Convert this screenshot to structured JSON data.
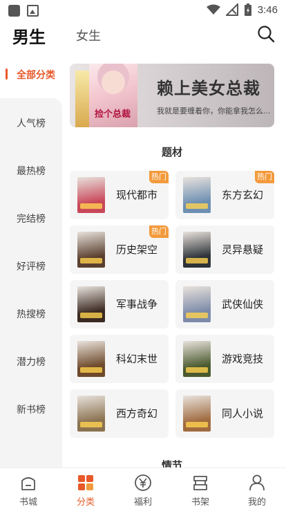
{
  "status_bar": {
    "time": "3:46"
  },
  "header": {
    "tabs": [
      {
        "label": "男生"
      },
      {
        "label": "女生"
      }
    ]
  },
  "sidebar": {
    "items": [
      {
        "label": "全部分类",
        "active": true
      },
      {
        "label": "人气榜"
      },
      {
        "label": "最热榜"
      },
      {
        "label": "完结榜"
      },
      {
        "label": "好评榜"
      },
      {
        "label": "热搜榜"
      },
      {
        "label": "潜力榜"
      },
      {
        "label": "新书榜"
      }
    ]
  },
  "banner": {
    "book_title": "捡个总裁",
    "title": "赖上美女总裁",
    "subtitle": "我就是要缠着你，你能拿我怎么..."
  },
  "sections": {
    "topic": "题材",
    "plot": "情节"
  },
  "categories": [
    {
      "label": "现代都市",
      "badge": "热门",
      "cover_color": "#c9475a"
    },
    {
      "label": "东方玄幻",
      "badge": "热门",
      "cover_color": "#6d8fb3"
    },
    {
      "label": "历史架空",
      "badge": "热门",
      "cover_color": "#5a3f2e"
    },
    {
      "label": "灵异悬疑",
      "badge": "",
      "cover_color": "#2e3339"
    },
    {
      "label": "军事战争",
      "badge": "",
      "cover_color": "#3b2a22"
    },
    {
      "label": "武侠仙侠",
      "badge": "",
      "cover_color": "#7d8ba8"
    },
    {
      "label": "科幻末世",
      "badge": "",
      "cover_color": "#6e4a2a"
    },
    {
      "label": "游戏竞技",
      "badge": "",
      "cover_color": "#4a5a2e"
    },
    {
      "label": "西方奇幻",
      "badge": "",
      "cover_color": "#8a7250"
    },
    {
      "label": "同人小说",
      "badge": "",
      "cover_color": "#a06b3f"
    }
  ],
  "bottom_nav": [
    {
      "label": "书城",
      "icon": "home-icon"
    },
    {
      "label": "分类",
      "icon": "category-icon",
      "active": true
    },
    {
      "label": "福利",
      "icon": "yen-coin-icon"
    },
    {
      "label": "书架",
      "icon": "bookshelf-icon"
    },
    {
      "label": "我的",
      "icon": "profile-icon"
    }
  ],
  "colors": {
    "accent": "#e8592a",
    "badge": "#f39a3c"
  }
}
